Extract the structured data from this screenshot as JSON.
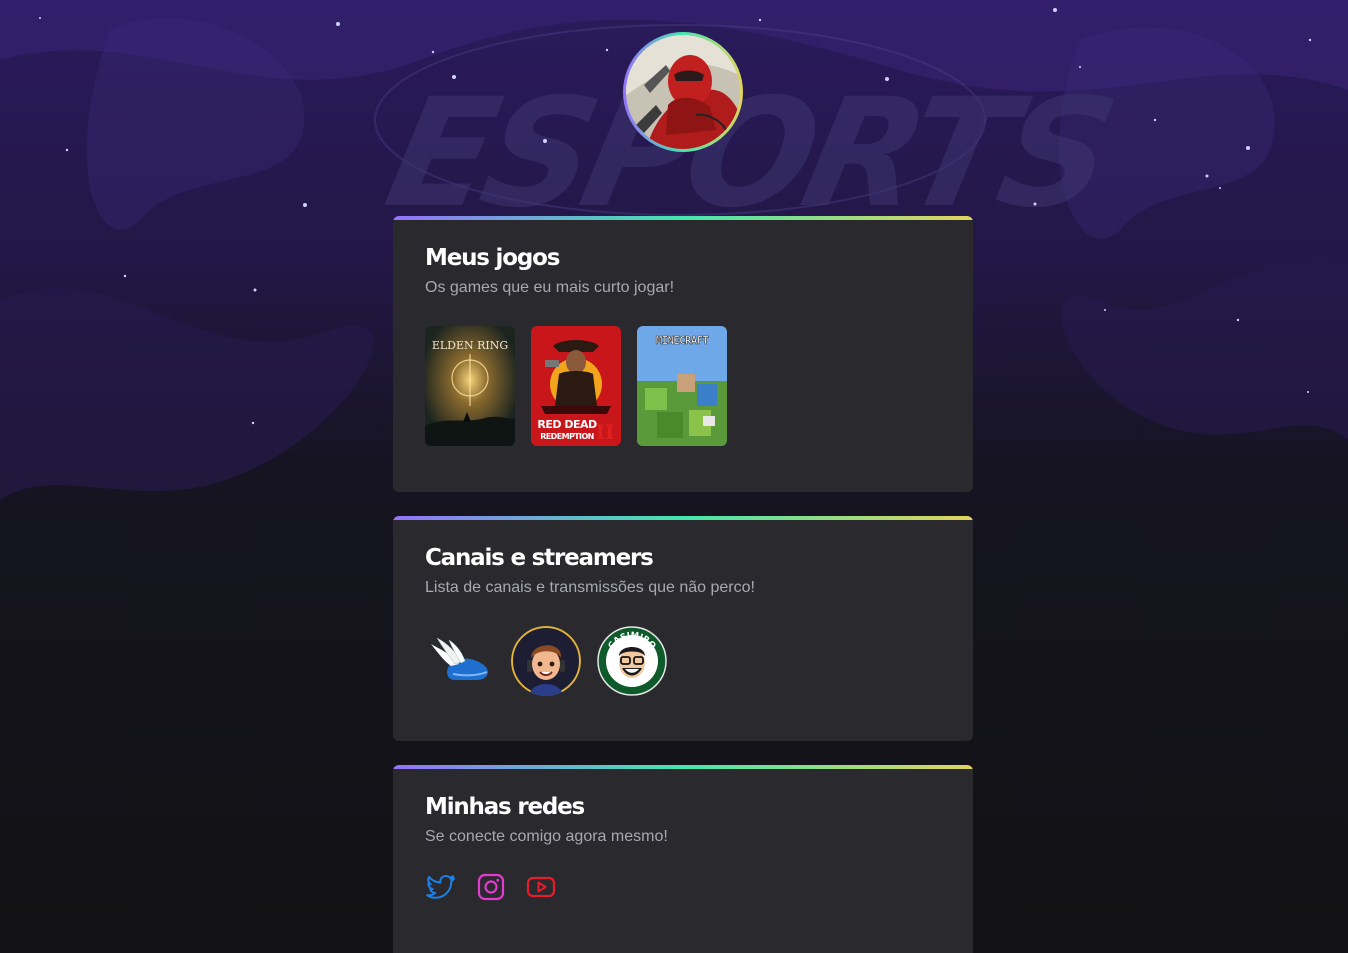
{
  "profile": {
    "avatar": "profile-avatar"
  },
  "games_section": {
    "title": "Meus jogos",
    "subtitle": "Os games que eu mais curto jogar!",
    "games": [
      {
        "cover": "elden-ring-cover",
        "title_line1": "ELDEN RING"
      },
      {
        "cover": "red-dead-redemption-cover",
        "title_line1": "RED DEAD",
        "title_line2": "REDEMPTION",
        "numeral": "II"
      },
      {
        "cover": "minecraft-cover",
        "title_line1": "MINECRAFT"
      }
    ]
  },
  "channels_section": {
    "title": "Canais e streamers",
    "subtitle": "Lista de canais e transmissões que não perco!",
    "channels": [
      {
        "icon": "winged-shoe-logo"
      },
      {
        "icon": "streamer-avatar"
      },
      {
        "icon": "casimiro-logo",
        "badge_text": "CASIMIRO"
      }
    ]
  },
  "social_section": {
    "title": "Minhas redes",
    "subtitle": "Se conecte comigo agora mesmo!",
    "links": [
      {
        "icon": "twitter-icon",
        "color": "#1d80e6"
      },
      {
        "icon": "instagram-icon",
        "color": "#e33bd1"
      },
      {
        "icon": "youtube-icon",
        "color": "#e81c2a"
      }
    ]
  },
  "colors": {
    "background": "#121214",
    "card": "#29292e",
    "gradient": [
      "#9572fc",
      "#43e7ad",
      "#e2d45c"
    ],
    "title": "#ffffff",
    "subtitle": "#a8a8b3"
  }
}
